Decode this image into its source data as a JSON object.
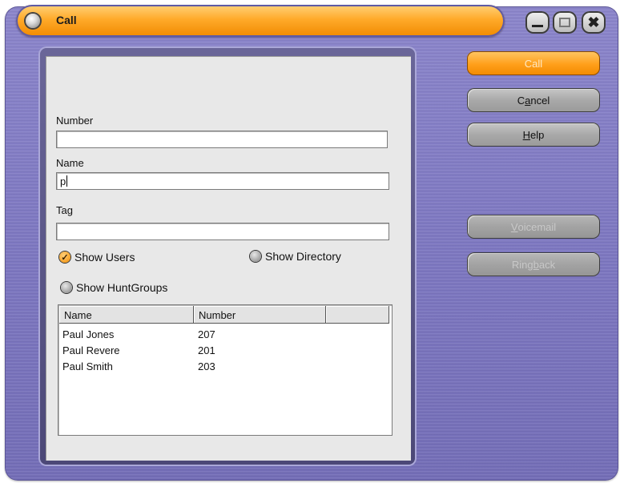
{
  "window": {
    "title": "Call"
  },
  "form": {
    "number_label": "Number",
    "number_value": "",
    "name_label": "Name",
    "name_value": "p",
    "tag_label": "Tag",
    "tag_value": "",
    "show_users_label": "Show Users",
    "show_users_checked": true,
    "show_directory_label": "Show Directory",
    "show_directory_checked": false,
    "show_huntgroups_label": "Show HuntGroups",
    "show_huntgroups_checked": false
  },
  "results": {
    "columns": [
      "Name",
      "Number",
      ""
    ],
    "rows": [
      {
        "name": "Paul Jones",
        "number": "207"
      },
      {
        "name": "Paul Revere",
        "number": "201"
      },
      {
        "name": "Paul Smith",
        "number": "203"
      }
    ]
  },
  "buttons": {
    "call": {
      "label": "Call",
      "enabled": true
    },
    "cancel": {
      "pre": "C",
      "mnemonic": "a",
      "post": "ncel",
      "enabled": true
    },
    "help": {
      "pre": "",
      "mnemonic": "H",
      "post": "elp",
      "enabled": true
    },
    "voicemail": {
      "pre": "",
      "mnemonic": "V",
      "post": "oicemail",
      "enabled": false
    },
    "ringback": {
      "pre": "Ring",
      "mnemonic": "b",
      "post": "ack",
      "enabled": false
    }
  },
  "colors": {
    "accent": "#ff9f1a",
    "frame": "#8c86cc"
  },
  "icons": {
    "window_orb": "radio-orb-icon",
    "minimize": "minimize-icon",
    "maximize": "maximize-icon",
    "close": "close-icon",
    "check_on": "checkmark-icon",
    "check_off": "unchecked-orb-icon"
  }
}
